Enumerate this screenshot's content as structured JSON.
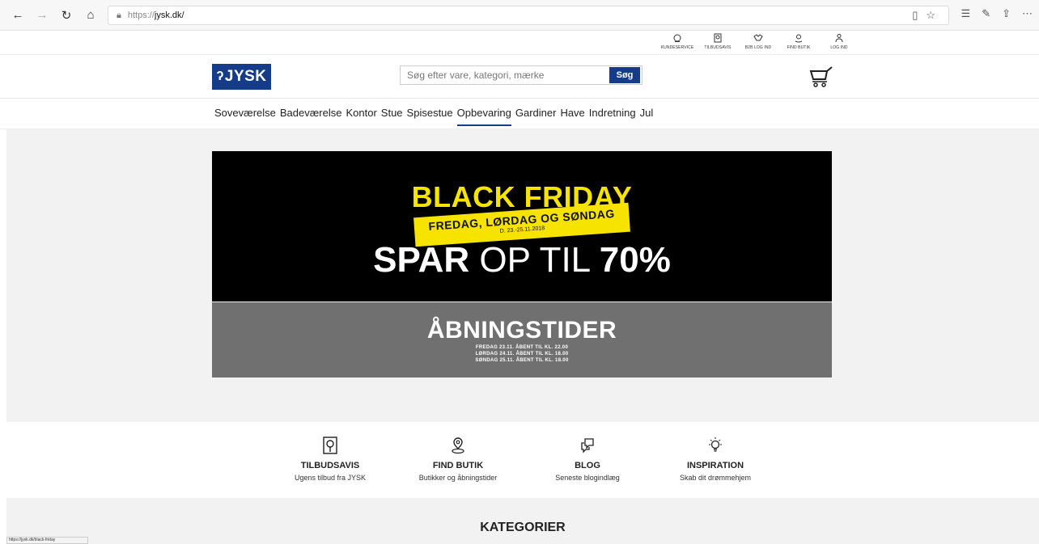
{
  "browser": {
    "url_protocol": "https://",
    "url_host": "jysk.dk/"
  },
  "utility": {
    "items": [
      "KUNDESERVICE",
      "TILBUDSAVIS",
      "B2B LOG IND",
      "FIND BUTIK",
      "LOG IND"
    ]
  },
  "header": {
    "logo_text": "JYSK",
    "search_placeholder": "Søg efter vare, kategori, mærke",
    "search_button": "Søg"
  },
  "nav": {
    "items": [
      "Soveværelse",
      "Badeværelse",
      "Kontor",
      "Stue",
      "Spisestue",
      "Opbevaring",
      "Gardiner",
      "Have",
      "Indretning",
      "Jul"
    ],
    "active_index": 5
  },
  "hero": {
    "title": "BLACK FRIDAY",
    "strip_line1": "FREDAG, LØRDAG OG SØNDAG",
    "strip_line2": "D. 23.-25.11.2018",
    "spar_bold": "SPAR",
    "spar_thin": " OP TIL ",
    "spar_pct": "70%",
    "hours_title": "ÅBNINGSTIDER",
    "hours_lines": [
      "FREDAG 23.11. ÅBENT TIL KL. 22.00",
      "LØRDAG 24.11. ÅBENT TIL KL. 18.00",
      "SØNDAG 25.11. ÅBENT TIL KL. 18.00"
    ]
  },
  "features": [
    {
      "title": "TILBUDSAVIS",
      "sub": "Ugens tilbud fra JYSK",
      "icon": "catalog-icon"
    },
    {
      "title": "FIND BUTIK",
      "sub": "Butikker og åbningstider",
      "icon": "location-pin-icon"
    },
    {
      "title": "BLOG",
      "sub": "Seneste blogindlæg",
      "icon": "chat-bubbles-icon"
    },
    {
      "title": "INSPIRATION",
      "sub": "Skab dit drømmehjem",
      "icon": "lightbulb-icon"
    }
  ],
  "categories_title": "KATEGORIER",
  "status_text": "https://jysk.dk/black-friday",
  "colors": {
    "brand_blue": "#143c8a",
    "promo_yellow": "#f6e400",
    "hero_black": "#000000",
    "hero_gray": "#707070"
  }
}
